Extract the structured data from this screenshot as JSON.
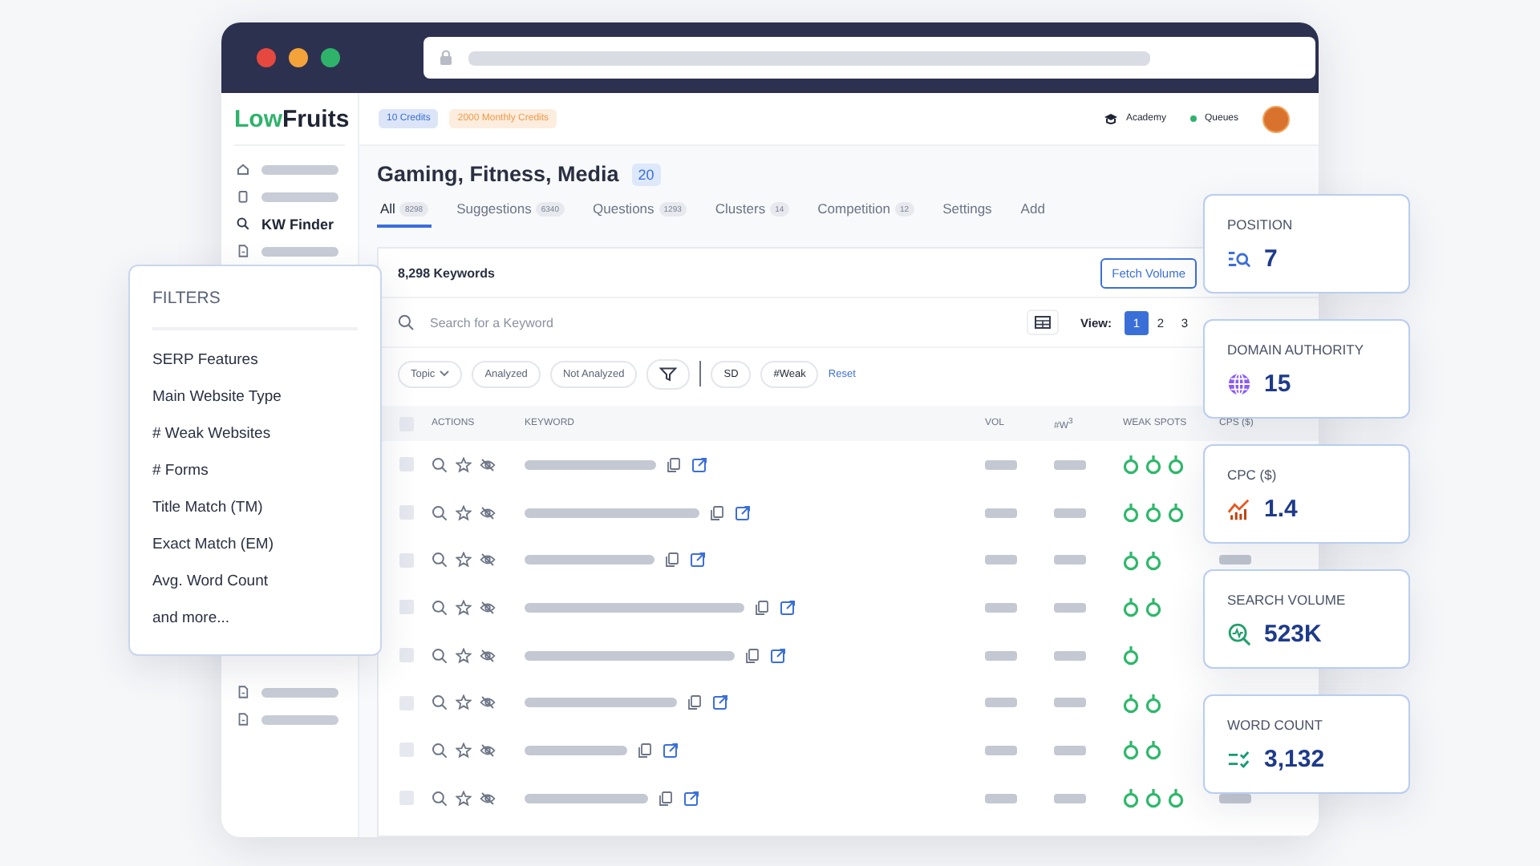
{
  "logo": {
    "accent": "Low",
    "rest": "Fruits"
  },
  "sidebar": {
    "items": [
      {
        "kind": "placeholder",
        "selected": false
      },
      {
        "kind": "placeholder",
        "selected": false
      },
      {
        "kind": "link",
        "label": "KW Finder",
        "selected": true
      },
      {
        "kind": "placeholder",
        "selected": false
      }
    ],
    "bottom_items": [
      {
        "kind": "placeholder",
        "selected": false
      },
      {
        "kind": "placeholder",
        "selected": false
      }
    ]
  },
  "header": {
    "badges": [
      {
        "label": "10 Credits",
        "color": "#3b6fd8"
      },
      {
        "label": "2000 Monthly Credits",
        "color": "#f09a4a"
      }
    ],
    "links": [
      {
        "kind": "academy",
        "label": "Academy"
      },
      {
        "kind": "queues",
        "label": "Queues"
      }
    ]
  },
  "project": {
    "title": "Gaming, Fitness, Media",
    "count": "20"
  },
  "tabs": [
    {
      "label": "All",
      "count": "8298",
      "selected": true
    },
    {
      "label": "Suggestions",
      "count": "6340",
      "selected": false
    },
    {
      "label": "Questions",
      "count": "1293",
      "selected": false
    },
    {
      "label": "Clusters",
      "count": "14",
      "selected": false
    },
    {
      "label": "Competition",
      "count": "12",
      "selected": false
    },
    {
      "label": "Settings",
      "selected": false
    },
    {
      "label": "Add",
      "selected": false
    }
  ],
  "keywords": {
    "total": "8,298 Keywords",
    "button": "Fetch Volume"
  },
  "search": {
    "placeholder": "Search for a Keyword"
  },
  "view": {
    "label": "View:",
    "options": [
      {
        "label": "1",
        "selected": true
      },
      {
        "label": "2",
        "selected": false
      },
      {
        "label": "3",
        "selected": false
      }
    ]
  },
  "chips": [
    {
      "kind": "dropdown",
      "label": "Topic"
    },
    {
      "kind": "chip",
      "label": "Analyzed"
    },
    {
      "kind": "chip",
      "label": "Not Analyzed"
    },
    {
      "kind": "filter"
    },
    {
      "kind": "divider"
    },
    {
      "kind": "chip",
      "label": "SD"
    },
    {
      "kind": "chip",
      "label": "#Weak"
    },
    {
      "kind": "link",
      "label": "Reset"
    }
  ],
  "table": {
    "columns": [
      "ACTIONS",
      "KEYWORD",
      "VOL",
      "#W$^{3}$",
      "WEAK SPOTS",
      "CPS ($)"
    ],
    "all_checked": false,
    "rows": [
      {
        "checked": false,
        "weak_spots": [
          {
            "kind": "weak"
          },
          {
            "kind": "weak"
          },
          {
            "kind": "weak"
          }
        ]
      },
      {
        "checked": false,
        "weak_spots": [
          {
            "kind": "weak"
          },
          {
            "kind": "weak"
          },
          {
            "kind": "weak"
          }
        ]
      },
      {
        "checked": false,
        "weak_spots": [
          {
            "kind": "weak"
          },
          {
            "kind": "weak"
          }
        ]
      },
      {
        "checked": false,
        "weak_spots": [
          {
            "kind": "weak"
          },
          {
            "kind": "weak"
          }
        ]
      },
      {
        "checked": false,
        "weak_spots": [
          {
            "kind": "weak"
          }
        ]
      },
      {
        "checked": false,
        "weak_spots": [
          {
            "kind": "weak"
          },
          {
            "kind": "weak"
          }
        ]
      },
      {
        "checked": false,
        "weak_spots": [
          {
            "kind": "weak"
          },
          {
            "kind": "weak"
          }
        ]
      },
      {
        "checked": false,
        "weak_spots": [
          {
            "kind": "weak"
          },
          {
            "kind": "weak"
          },
          {
            "kind": "weak"
          }
        ]
      }
    ]
  },
  "filters": {
    "title": "FILTERS",
    "items": [
      "SERP Features",
      "Main Website Type",
      "# Weak Websites",
      "# Forms",
      "Title Match (TM)",
      "Exact Match (EM)",
      "Avg. Word Count",
      "and more..."
    ]
  },
  "stats": [
    {
      "kind": "position",
      "label": "POSITION",
      "value": "7"
    },
    {
      "kind": "authority",
      "label": "DOMAIN AUTHORITY",
      "value": "15"
    },
    {
      "kind": "cpc",
      "label": "CPC ($)",
      "value": "1.4"
    },
    {
      "kind": "volume",
      "label": "SEARCH VOLUME",
      "value": "523K"
    },
    {
      "kind": "words",
      "label": "WORD COUNT",
      "value": "3,132"
    }
  ]
}
